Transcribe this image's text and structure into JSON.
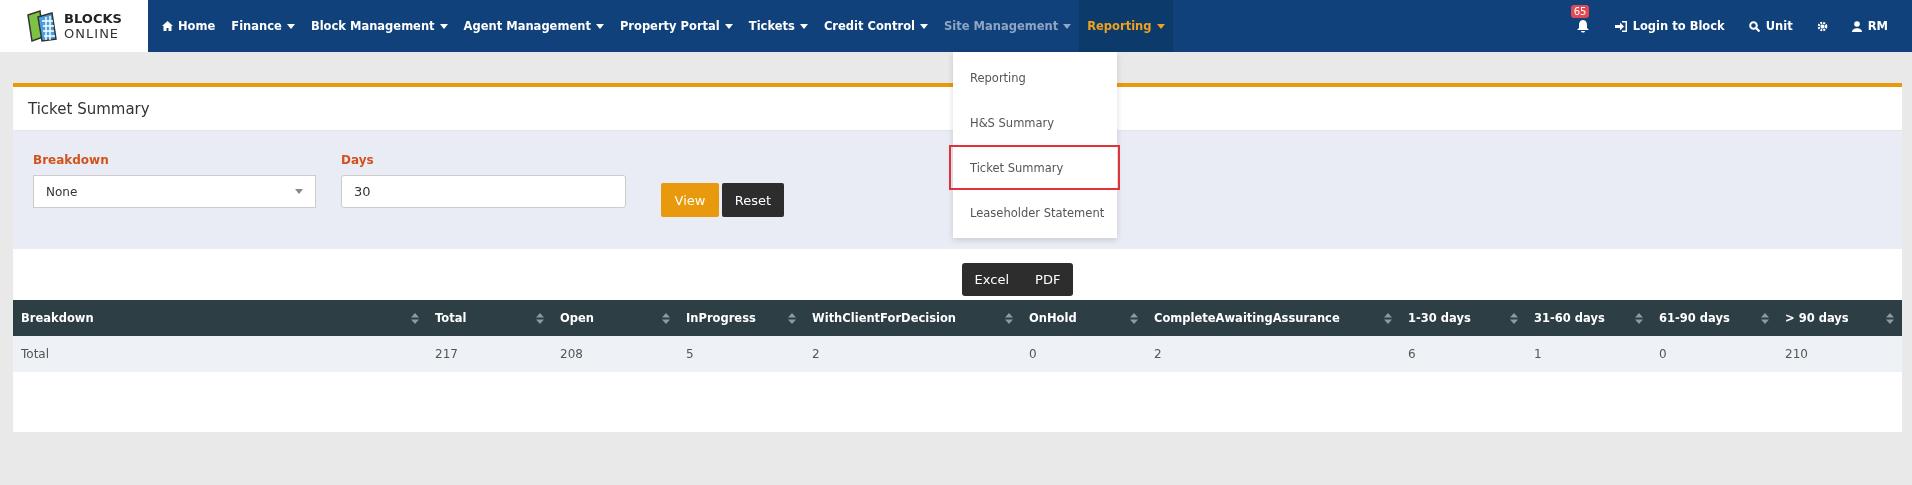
{
  "logo": {
    "line_1": "BLOCKS",
    "line_2": "ONLINE"
  },
  "nav": [
    {
      "label": "Home",
      "kind": "home",
      "selected": false,
      "disabled": false
    },
    {
      "label": "Finance",
      "kind": "dropdown",
      "selected": false,
      "disabled": false
    },
    {
      "label": "Block Management",
      "kind": "dropdown",
      "selected": false,
      "disabled": false
    },
    {
      "label": "Agent Management",
      "kind": "dropdown",
      "selected": false,
      "disabled": false
    },
    {
      "label": "Property Portal",
      "kind": "dropdown",
      "selected": false,
      "disabled": false
    },
    {
      "label": "Tickets",
      "kind": "dropdown",
      "selected": false,
      "disabled": false
    },
    {
      "label": "Credit Control",
      "kind": "dropdown",
      "selected": false,
      "disabled": false
    },
    {
      "label": "Site Management",
      "kind": "dropdown",
      "selected": false,
      "disabled": true
    },
    {
      "label": "Reporting",
      "kind": "dropdown",
      "selected": true,
      "disabled": false
    }
  ],
  "nav_right": {
    "notifications": "65",
    "login": "Login to Block",
    "search": "Unit",
    "user": "RM"
  },
  "dropdown": [
    {
      "label": "Reporting",
      "selected": false
    },
    {
      "label": "H&S Summary",
      "selected": false
    },
    {
      "label": "Ticket Summary",
      "selected": true
    },
    {
      "label": "Leaseholder Statement",
      "selected": false
    }
  ],
  "page": {
    "title": "Ticket Summary",
    "filters": [
      {
        "label": "Breakdown",
        "kind": "select",
        "value": "None"
      },
      {
        "label": "Days",
        "kind": "input",
        "value": "30"
      }
    ],
    "buttons": {
      "view": "View",
      "reset": "Reset"
    },
    "export": [
      "Excel",
      "PDF"
    ],
    "table": {
      "columns": [
        "Breakdown",
        "Total",
        "Open",
        "InProgress",
        "WithClientForDecision",
        "OnHold",
        "CompleteAwaitingAssurance",
        "1-30 days",
        "31-60 days",
        "61-90 days",
        "> 90 days"
      ],
      "rows": [
        [
          "Total",
          "217",
          "208",
          "5",
          "2",
          "0",
          "2",
          "6",
          "1",
          "0",
          "210"
        ]
      ]
    }
  }
}
